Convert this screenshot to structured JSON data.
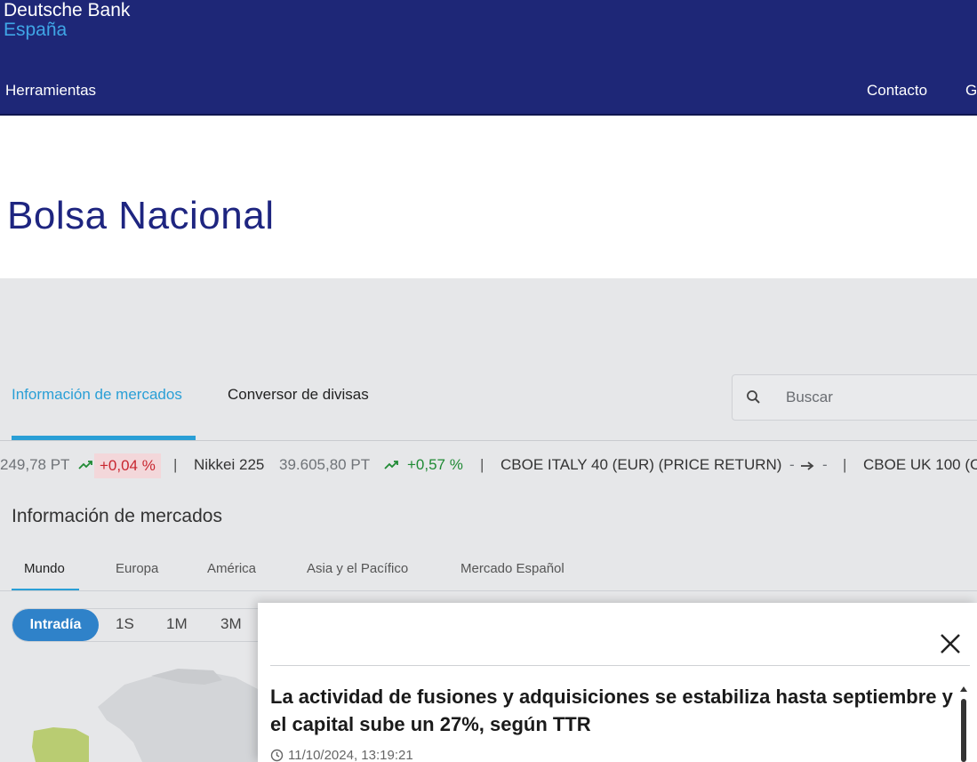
{
  "header": {
    "brand_name": "Deutsche Bank",
    "brand_sub": "España",
    "nav_tools": "Herramientas",
    "nav_contact": "Contacto",
    "nav_cut": "G"
  },
  "page": {
    "title": "Bolsa Nacional"
  },
  "main_tabs": [
    {
      "label": "Información de mercados",
      "active": true
    },
    {
      "label": "Conversor de divisas",
      "active": false
    }
  ],
  "search": {
    "placeholder": "Buscar"
  },
  "ticker": {
    "items": [
      {
        "value": "249,78 PT",
        "change": "+0,04 %",
        "direction": "up"
      },
      {
        "name": "Nikkei 225",
        "value": "39.605,80 PT",
        "change": "+0,57 %",
        "direction": "up"
      },
      {
        "name": "CBOE ITALY 40 (EUR) (PRICE RETURN)",
        "value": "-",
        "change": "-",
        "direction": "flat"
      },
      {
        "name": "CBOE UK 100 (C"
      }
    ],
    "separator": "|"
  },
  "market_section": {
    "title": "Información de mercados",
    "region_tabs": [
      "Mundo",
      "Europa",
      "América",
      "Asia y el Pacífico",
      "Mercado Español"
    ],
    "active_region": "Mundo",
    "periods": [
      "Intradía",
      "1S",
      "1M",
      "3M"
    ],
    "active_period": "Intradía"
  },
  "news_popup": {
    "title": "La actividad de fusiones y adquisiciones se estabiliza hasta septiembre y el capital sube un 27%, según TTR",
    "timestamp": "11/10/2024, 13:19:21"
  },
  "colors": {
    "header_bg": "#1e2777",
    "accent": "#2a9fd6",
    "title_blue": "#1e2580",
    "positive": "#1f8a34",
    "negative": "#c8262f"
  }
}
